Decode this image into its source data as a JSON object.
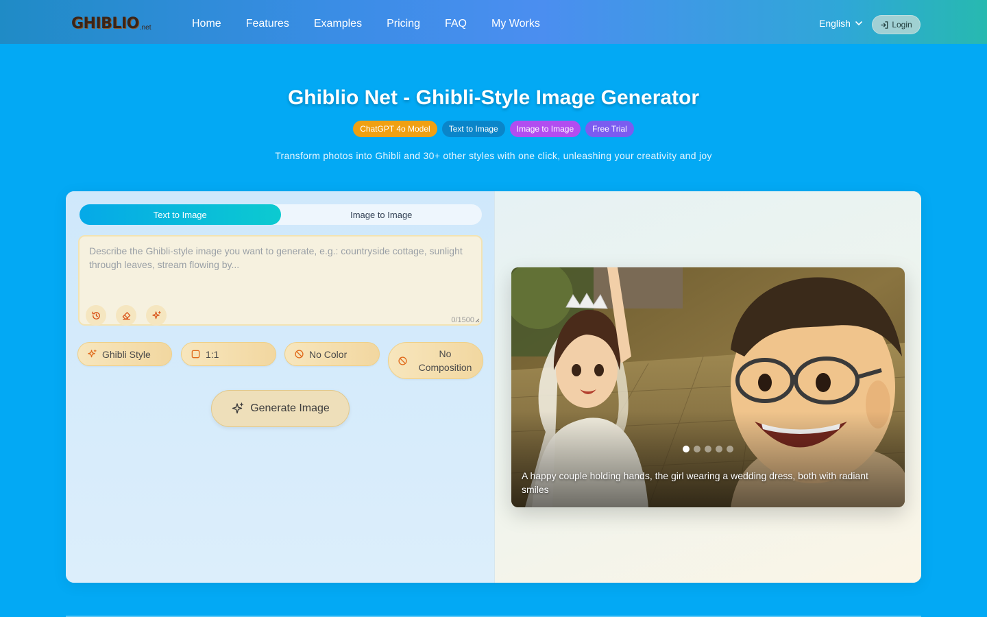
{
  "brand": {
    "logo_main": "GHIBLIO",
    "logo_sub": ".net"
  },
  "nav": {
    "items": [
      {
        "label": "Home"
      },
      {
        "label": "Features"
      },
      {
        "label": "Examples"
      },
      {
        "label": "Pricing"
      },
      {
        "label": "FAQ"
      },
      {
        "label": "My Works"
      }
    ],
    "language": "English",
    "login_label": "Login"
  },
  "hero": {
    "title": "Ghiblio Net - Ghibli-Style Image Generator",
    "badges": [
      {
        "label": "ChatGPT 4o Model",
        "color": "#f0a012"
      },
      {
        "label": "Text to Image",
        "color": "#0a85c9"
      },
      {
        "label": "Image to Image",
        "color": "#b24df0"
      },
      {
        "label": "Free Trial",
        "color": "#7b5cf0"
      }
    ],
    "subtitle": "Transform photos into Ghibli and 30+ other styles with one click, unleashing your creativity and joy"
  },
  "generator": {
    "tabs": [
      {
        "label": "Text to Image",
        "active": true
      },
      {
        "label": "Image to Image",
        "active": false
      }
    ],
    "prompt": {
      "value": "",
      "placeholder": "Describe the Ghibli-style image you want to generate, e.g.: countryside cottage, sunlight through leaves, stream flowing by...",
      "counter": "0/1500"
    },
    "tool_icons": [
      "history-icon",
      "eraser-icon",
      "sparkle-icon"
    ],
    "options": {
      "style": "Ghibli Style",
      "ratio": "1:1",
      "color": "No Color",
      "composition_line1": "No",
      "composition_line2": "Composition"
    },
    "generate_label": "Generate Image"
  },
  "showcase": {
    "caption": "A happy couple holding hands, the girl wearing a wedding dress, both with radiant smiles",
    "slide_count": 5,
    "active_slide": 0
  },
  "colors": {
    "page_bg": "#03a9f4",
    "accent_tab": "#05a9e8",
    "option_bg": "#f2d7a0",
    "icon_orange": "#e06a1b"
  }
}
